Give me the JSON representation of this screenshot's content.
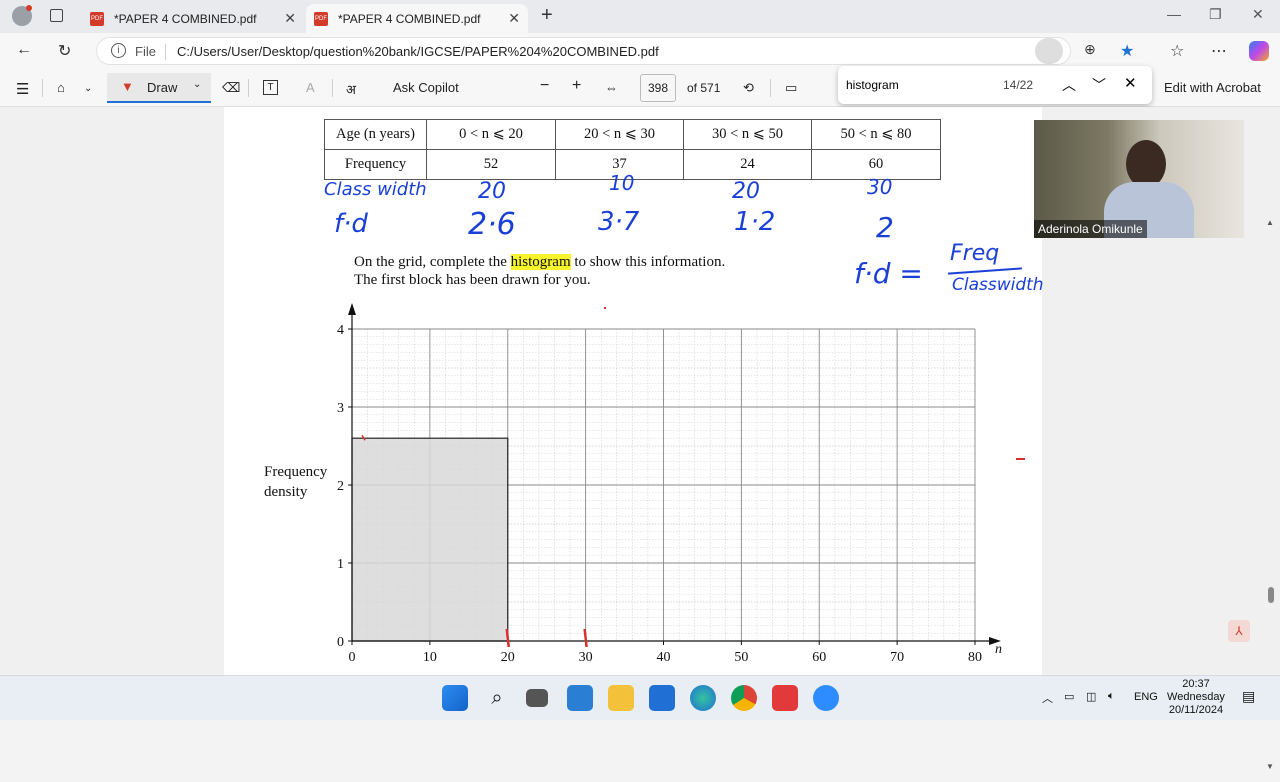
{
  "tabs": [
    {
      "title": "*PAPER 4 COMBINED.pdf"
    },
    {
      "title": "*PAPER 4 COMBINED.pdf"
    }
  ],
  "address": {
    "file_label": "File",
    "url": "C:/Users/User/Desktop/question%20bank/IGCSE/PAPER%204%20COMBINED.pdf"
  },
  "toolbar": {
    "draw": "Draw",
    "ask_copilot": "Ask Copilot",
    "page_number": "398",
    "page_total": "of 571",
    "edit_acrobat": "Edit with Acrobat"
  },
  "find": {
    "query": "histogram",
    "count": "14/22"
  },
  "table": {
    "header_label": "Age (n years)",
    "row_label": "Frequency",
    "columns": [
      "0 < n ⩽ 20",
      "20 < n ⩽ 30",
      "30 < n ⩽ 50",
      "50 < n ⩽ 80"
    ],
    "frequencies": [
      "52",
      "37",
      "24",
      "60"
    ]
  },
  "handwriting": {
    "class_width_label": "Class width",
    "class_widths": [
      "20",
      "10",
      "20",
      "30"
    ],
    "fd_label": "f·d",
    "fd_values": [
      "2·6",
      "3·7",
      "1·2",
      "2"
    ],
    "formula_lhs": "f·d =",
    "formula_num": "Freq",
    "formula_den": "Classwidth"
  },
  "question": {
    "pre": "On the grid, complete the ",
    "highlight": "histogram",
    "post": " to show this information.",
    "line2": "The first block has been drawn for you."
  },
  "chart_data": {
    "type": "bar",
    "ylabel": "Frequency density",
    "xlabel": "n",
    "x_ticks": [
      "0",
      "10",
      "20",
      "30",
      "40",
      "50",
      "60",
      "70",
      "80"
    ],
    "y_ticks": [
      "0",
      "1",
      "2",
      "3",
      "4"
    ],
    "xlim": [
      0,
      80
    ],
    "ylim": [
      0,
      4
    ],
    "bars": [
      {
        "x_from": 0,
        "x_to": 20,
        "height": 2.6
      }
    ]
  },
  "webcam": {
    "name": "Aderinola Omikunle"
  },
  "tray": {
    "lang": "ENG",
    "time": "20:37",
    "day": "Wednesday",
    "date": "20/11/2024"
  },
  "colors": {
    "highlight": "#f6f32a",
    "ink_blue": "#1a3fd6",
    "ink_red": "#d9302a",
    "bar_fill": "#d8d8d8"
  }
}
